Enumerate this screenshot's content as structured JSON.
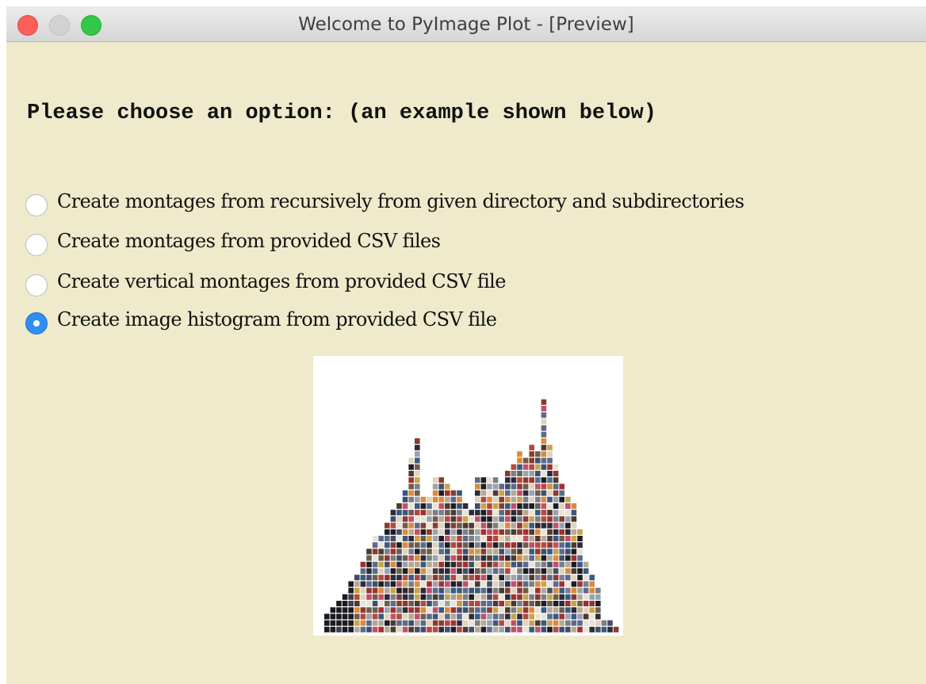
{
  "window": {
    "title": "Welcome to PyImage Plot - [Preview]"
  },
  "prompt": "Please choose an option: (an example shown below)",
  "options": [
    {
      "label": "Create montages from recursively from given directory and subdirectories",
      "selected": false
    },
    {
      "label": "Create montages from provided CSV files",
      "selected": false
    },
    {
      "label": "Create vertical montages from provided CSV file",
      "selected": false
    },
    {
      "label": "Create image histogram from provided CSV file",
      "selected": true
    }
  ],
  "colors": {
    "background": "#eeeacb",
    "radio_selected": "#2f8ff0"
  },
  "preview": {
    "type": "image histogram",
    "column_heights": [
      3,
      4,
      5,
      6,
      8,
      9,
      11,
      13,
      15,
      15,
      17,
      19,
      20,
      22,
      27,
      30,
      21,
      21,
      24,
      24,
      23,
      22,
      22,
      20,
      19,
      24,
      24,
      24,
      24,
      23,
      25,
      26,
      28,
      27,
      29,
      28,
      36,
      29,
      26,
      23,
      21,
      20,
      16,
      11,
      9,
      7,
      2,
      2,
      1
    ]
  }
}
